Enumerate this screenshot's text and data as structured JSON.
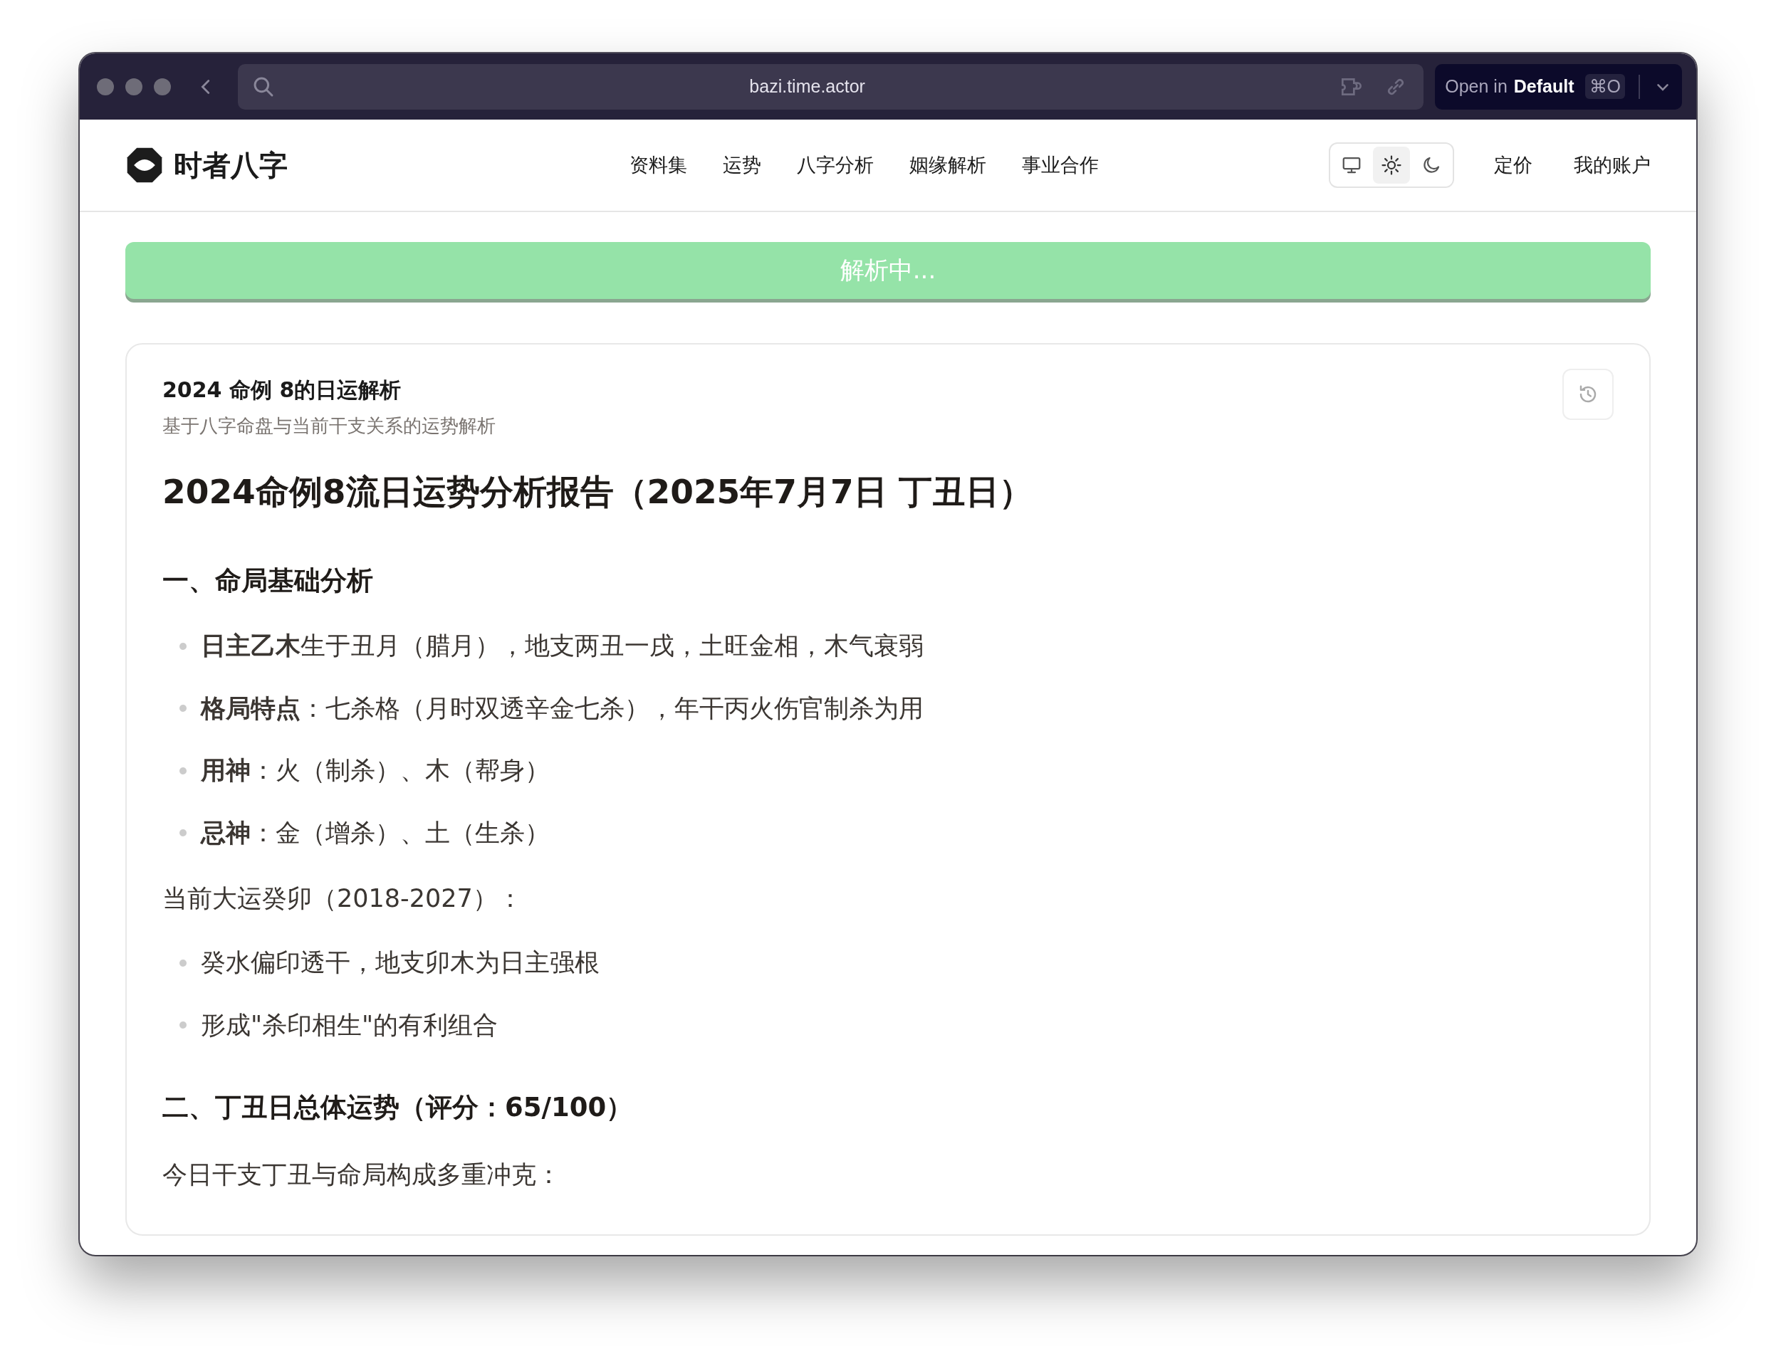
{
  "browser": {
    "url": "bazi.time.actor",
    "open_button": {
      "prefix": "Open in",
      "app": "Default",
      "shortcut": "⌘O"
    }
  },
  "site": {
    "logo": "时者八字",
    "nav": [
      "资料集",
      "运势",
      "八字分析",
      "姻缘解析",
      "事业合作"
    ],
    "theme_options": [
      {
        "kind": "monitor",
        "selected": false
      },
      {
        "kind": "sun",
        "selected": true
      },
      {
        "kind": "moon",
        "selected": false
      }
    ],
    "links": [
      "定价",
      "我的账户"
    ]
  },
  "status_bar": {
    "label": "解析中..."
  },
  "card": {
    "title": "2024 命例 8的日运解析",
    "subtitle": "基于八字命盘与当前干支关系的运势解析",
    "content": [
      {
        "kind": "h1",
        "text": "2024命例8流日运势分析报告（2025年7月7日 丁丑日）"
      },
      {
        "kind": "h2",
        "text": "一、命局基础分析"
      },
      {
        "kind": "list",
        "items": [
          "**日主乙木**生于丑月（腊月），地支两丑一戌，土旺金相，木气衰弱",
          "**格局特点**：七杀格（月时双透辛金七杀），年干丙火伤官制杀为用",
          "**用神**：火（制杀）、木（帮身）",
          "**忌神**：金（增杀）、土（生杀）"
        ]
      },
      {
        "kind": "p",
        "text": "当前大运癸卯（2018-2027）："
      },
      {
        "kind": "list",
        "items": [
          "癸水偏印透干，地支卯木为日主强根",
          "形成\"杀印相生\"的有利组合"
        ]
      },
      {
        "kind": "h2",
        "text": "二、丁丑日总体运势（评分：65/100）"
      },
      {
        "kind": "p",
        "text": "今日干支丁丑与命局构成多重冲克："
      }
    ]
  }
}
